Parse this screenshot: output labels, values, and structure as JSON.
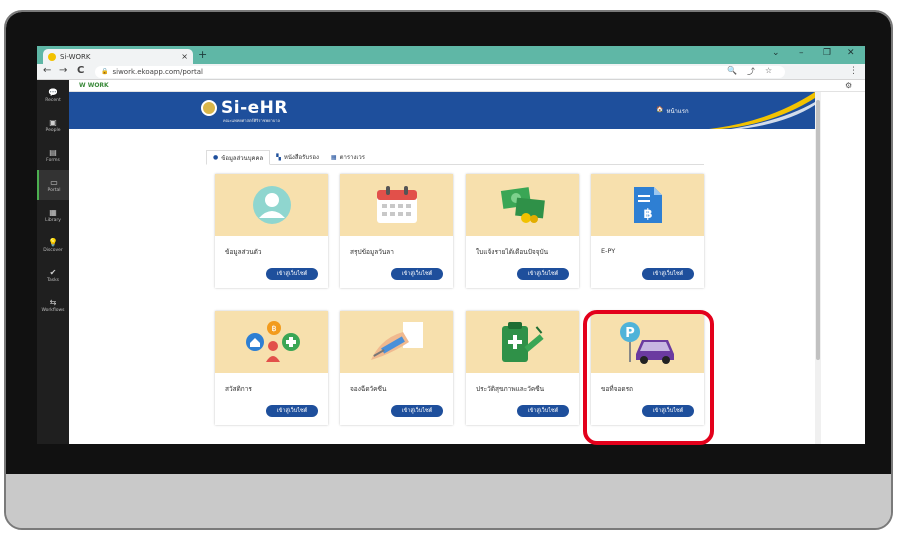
{
  "browser": {
    "tab_title": "Si-WORK",
    "url": "siwork.ekoapp.com/portal",
    "new_tab_symbol": "+",
    "close_symbol": "×",
    "back_symbol": "←",
    "forward_symbol": "→",
    "reload_symbol": "C",
    "lock_symbol": "🔒",
    "zoom_symbol": "🔍",
    "share_symbol": "⤴",
    "star_symbol": "☆",
    "menu_symbol": "⋮",
    "win_chevron": "⌄",
    "win_min": "–",
    "win_max": "❐",
    "win_close": "✕"
  },
  "app": {
    "logo_text": "W WORK",
    "gear_symbol": "⚙",
    "sidebar": [
      {
        "label": "Recent",
        "icon": "chat-icon",
        "glyph": "💬"
      },
      {
        "label": "People",
        "icon": "people-icon",
        "glyph": "▣"
      },
      {
        "label": "Forms",
        "icon": "form-icon",
        "glyph": "▤"
      },
      {
        "label": "Portal",
        "icon": "portal-icon",
        "glyph": "▭",
        "active": true
      },
      {
        "label": "Library",
        "icon": "library-icon",
        "glyph": "▦"
      },
      {
        "label": "Discover",
        "icon": "discover-icon",
        "glyph": "💡"
      },
      {
        "label": "Tasks",
        "icon": "task-icon",
        "glyph": "✔"
      },
      {
        "label": "Workflows",
        "icon": "workflow-icon",
        "glyph": "⇆"
      }
    ]
  },
  "banner": {
    "name": "Si-eHR",
    "subtitle": "คณะแพทยศาสตร์ศิริราชพยาบาล",
    "home_label": "หน้าแรก",
    "home_symbol": "🏠"
  },
  "tabs": [
    {
      "label": "ข้อมูลส่วนบุคคล",
      "icon": "user-circle-icon",
      "glyph": "●",
      "active": true
    },
    {
      "label": "หนังสือรับรอง",
      "icon": "documents-icon",
      "glyph": "▚"
    },
    {
      "label": "ตารางเวร",
      "icon": "table-icon",
      "glyph": "▦"
    }
  ],
  "cards": [
    {
      "label": "ข้อมูลส่วนตัว",
      "button": "เข้าสู่เว็บไซต์",
      "icon": "user-profile-icon"
    },
    {
      "label": "สรุปข้อมูลวันลา",
      "button": "เข้าสู่เว็บไซต์",
      "icon": "calendar-icon"
    },
    {
      "label": "ใบแจ้งรายได้เดือนปัจจุบัน",
      "button": "เข้าสู่เว็บไซต์",
      "icon": "money-icon"
    },
    {
      "label": "E-PY",
      "button": "เข้าสู่เว็บไซต์",
      "icon": "baht-document-icon"
    },
    {
      "label": "สวัสดิการ",
      "button": "เข้าสู่เว็บไซต์",
      "icon": "welfare-icon"
    },
    {
      "label": "จองฉีดวัคซีน",
      "button": "เข้าสู่เว็บไซต์",
      "icon": "vaccine-icon"
    },
    {
      "label": "ประวัติสุขภาพและวัคซีน",
      "button": "เข้าสู่เว็บไซต์",
      "icon": "health-record-icon"
    },
    {
      "label": "ขอที่จอดรถ",
      "button": "เข้าสู่เว็บไซต์",
      "icon": "parking-car-icon"
    }
  ],
  "colors": {
    "brand_blue": "#1e4f9c",
    "card_top": "#f7e0ad",
    "highlight": "#e3001b",
    "tab_teal": "#5fb7a6"
  }
}
